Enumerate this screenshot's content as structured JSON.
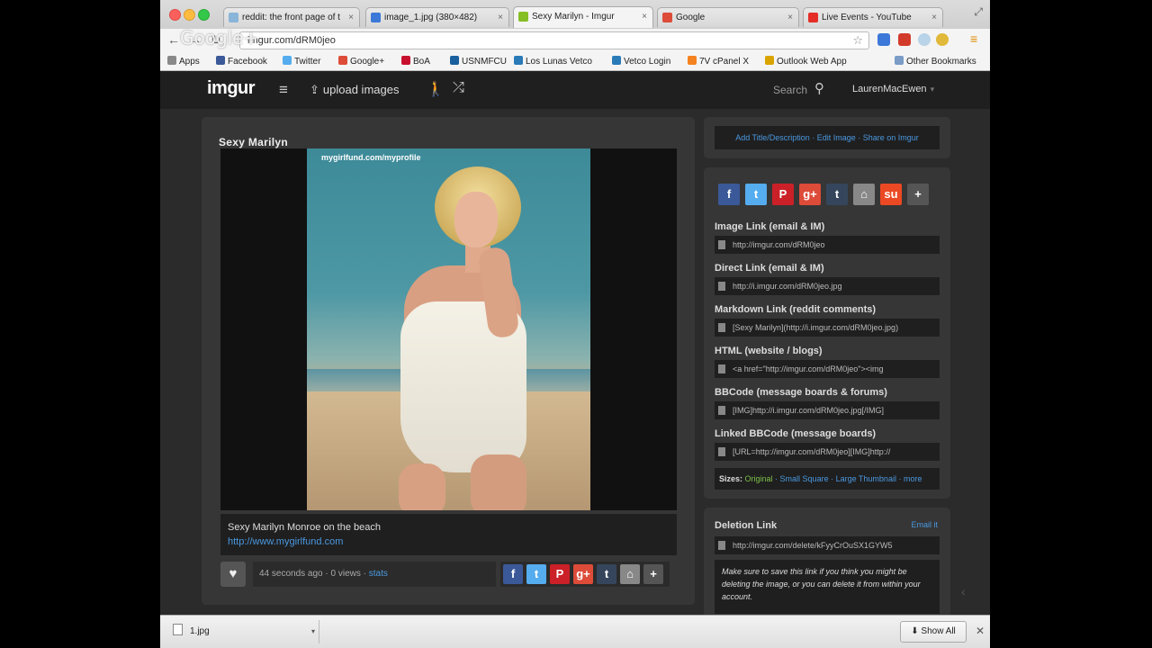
{
  "browser": {
    "tabs": [
      {
        "label": "reddit: the front page of t",
        "color": "#8ab4d8"
      },
      {
        "label": "image_1.jpg (380×482)",
        "color": "#3c78d8"
      },
      {
        "label": "Sexy Marilyn - Imgur",
        "color": "#85bf25"
      },
      {
        "label": "Google",
        "color": "#dd4b39"
      },
      {
        "label": "Live Events - YouTube",
        "color": "#e52d27"
      }
    ],
    "url": "imgur.com/dRM0jeo",
    "google_now": "Google+",
    "bookmarks": [
      {
        "label": "Apps",
        "color": "#888"
      },
      {
        "label": "Facebook",
        "color": "#3b5998"
      },
      {
        "label": "Twitter",
        "color": "#55acee"
      },
      {
        "label": "Google+",
        "color": "#dd4b39"
      },
      {
        "label": "BoA",
        "color": "#c8102e"
      },
      {
        "label": "USNMFCU",
        "color": "#1a5f9e"
      },
      {
        "label": "Los Lunas Vetco",
        "color": "#2a7ab8"
      },
      {
        "label": "Vetco Login",
        "color": "#2a7ab8"
      },
      {
        "label": "7V cPanel X",
        "color": "#f58220"
      },
      {
        "label": "Outlook Web App",
        "color": "#d9a400"
      },
      {
        "label": "Other Bookmarks",
        "color": "#7a9cc6"
      }
    ]
  },
  "imgur": {
    "logo": "imgur",
    "upload_label": "upload images",
    "search_label": "Search",
    "username": "LaurenMacEwen",
    "image": {
      "title": "Sexy Marilyn",
      "watermark": "mygirlfund.com/myprofile",
      "description": "Sexy Marilyn Monroe on the beach",
      "link": "http://www.mygirlfund.com",
      "time": "44 seconds ago",
      "views": "0 views",
      "stats_label": "stats"
    },
    "share_post": [
      {
        "icon": "f",
        "color": "#3b5998"
      },
      {
        "icon": "t",
        "color": "#55acee"
      },
      {
        "icon": "P",
        "color": "#cb2027"
      },
      {
        "icon": "g+",
        "color": "#dd4b39"
      },
      {
        "icon": "t",
        "color": "#35465c"
      },
      {
        "icon": "⌂",
        "color": "#888888"
      },
      {
        "icon": "+",
        "color": "#555555"
      }
    ],
    "edit_bar": "Add Title/Description · Edit Image · Share on Imgur",
    "share_side": [
      {
        "icon": "f",
        "color": "#3b5998"
      },
      {
        "icon": "t",
        "color": "#55acee"
      },
      {
        "icon": "P",
        "color": "#cb2027"
      },
      {
        "icon": "g+",
        "color": "#dd4b39"
      },
      {
        "icon": "t",
        "color": "#35465c"
      },
      {
        "icon": "⌂",
        "color": "#888888"
      },
      {
        "icon": "su",
        "color": "#eb4924"
      },
      {
        "icon": "+",
        "color": "#555555"
      }
    ],
    "links": [
      {
        "label": "Image Link (email & IM)",
        "value": "http://imgur.com/dRM0jeo"
      },
      {
        "label": "Direct Link (email & IM)",
        "value": "http://i.imgur.com/dRM0jeo.jpg"
      },
      {
        "label": "Markdown Link (reddit comments)",
        "value": "[Sexy Marilyn](http://i.imgur.com/dRM0jeo.jpg)"
      },
      {
        "label": "HTML (website / blogs)",
        "value": "<a href=\"http://imgur.com/dRM0jeo\"><img"
      },
      {
        "label": "BBCode (message boards & forums)",
        "value": "[IMG]http://i.imgur.com/dRM0jeo.jpg[/IMG]"
      },
      {
        "label": "Linked BBCode (message boards)",
        "value": "[URL=http://imgur.com/dRM0jeo][IMG]http://"
      }
    ],
    "sizes": {
      "label": "Sizes:",
      "original": "Original",
      "rest": " · Small Square · Large Thumbnail · more"
    },
    "deletion": {
      "label": "Deletion Link",
      "email": "Email it",
      "value": "http://imgur.com/delete/kFyyCrOuSX1GYW5",
      "note": "Make sure to save this link if you think you might be deleting the image, or you can delete it from within your account."
    }
  },
  "downloads": {
    "file": "1.jpg",
    "show_all": "Show All"
  }
}
